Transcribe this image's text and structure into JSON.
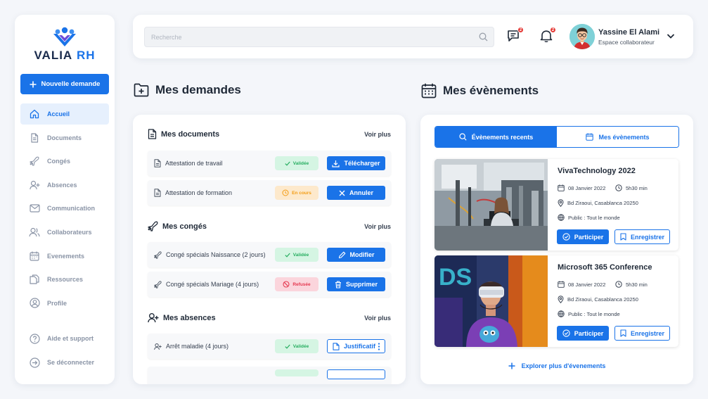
{
  "brand": {
    "name_part1": "VALIA",
    "name_part2": "RH"
  },
  "sidebar": {
    "new_request_label": "Nouvelle demande",
    "items": [
      {
        "label": "Accueil",
        "icon": "home-icon",
        "active": true
      },
      {
        "label": "Documents",
        "icon": "document-icon"
      },
      {
        "label": "Congés",
        "icon": "plane-icon"
      },
      {
        "label": "Absences",
        "icon": "user-plus-icon"
      },
      {
        "label": "Communication",
        "icon": "mail-icon"
      },
      {
        "label": "Collaborateurs",
        "icon": "users-icon"
      },
      {
        "label": "Evenements",
        "icon": "calendar-icon"
      },
      {
        "label": "Ressources",
        "icon": "copy-icon"
      },
      {
        "label": "Profile",
        "icon": "user-circle-icon"
      }
    ],
    "bottom_items": [
      {
        "label": "Aide et support",
        "icon": "help-icon"
      },
      {
        "label": "Se déconnecter",
        "icon": "logout-icon"
      }
    ]
  },
  "header": {
    "search_placeholder": "Recherche",
    "messages_count": "2",
    "notifications_count": "2",
    "user_name": "Yassine El Alami",
    "user_role": "Espace collaborateur"
  },
  "demandes": {
    "title": "Mes demandes",
    "documents": {
      "title": "Mes documents",
      "see_more": "Voir plus",
      "rows": [
        {
          "label": "Attestation de travail",
          "status": "Validée",
          "action": "Télécharger"
        },
        {
          "label": "Attestation de formation",
          "status": "En cours",
          "action": "Annuler"
        }
      ]
    },
    "conges": {
      "title": "Mes congés",
      "see_more": "Voir plus",
      "rows": [
        {
          "label": "Congé spécials Naissance (2 jours)",
          "status": "Validée",
          "action": "Modifier"
        },
        {
          "label": "Congé spécials Mariage (4 jours)",
          "status": "Refusée",
          "action": "Supprimer"
        }
      ]
    },
    "absences": {
      "title": "Mes absences",
      "see_more": "Voir plus",
      "rows": [
        {
          "label": "Arrêt maladie (4 jours)",
          "status": "Validée",
          "action": "Justificatif"
        }
      ]
    }
  },
  "events": {
    "title": "Mes évènements",
    "tab_recent": "Évènements recents",
    "tab_mine": "Mes évènements",
    "items": [
      {
        "title": "VivaTechnology 2022",
        "date": "08 Janvier 2022",
        "time": "5h30 min",
        "address": "Bd Ziraoui, Casablanca 20250",
        "audience": "Public : Tout le monde",
        "participate": "Participer",
        "save": "Enregistrer"
      },
      {
        "title": "Microsoft 365 Conference",
        "date": "08 Janvier 2022",
        "time": "5h30 min",
        "address": "Bd Ziraoui, Casablanca 20250",
        "audience": "Public : Tout le monde",
        "participate": "Participer",
        "save": "Enregistrer"
      }
    ],
    "explore_label": "Explorer plus d'évenements"
  },
  "colors": {
    "accent": "#1a73e8",
    "success": "#27ae60",
    "warning": "#f39c12",
    "danger": "#e53950"
  }
}
